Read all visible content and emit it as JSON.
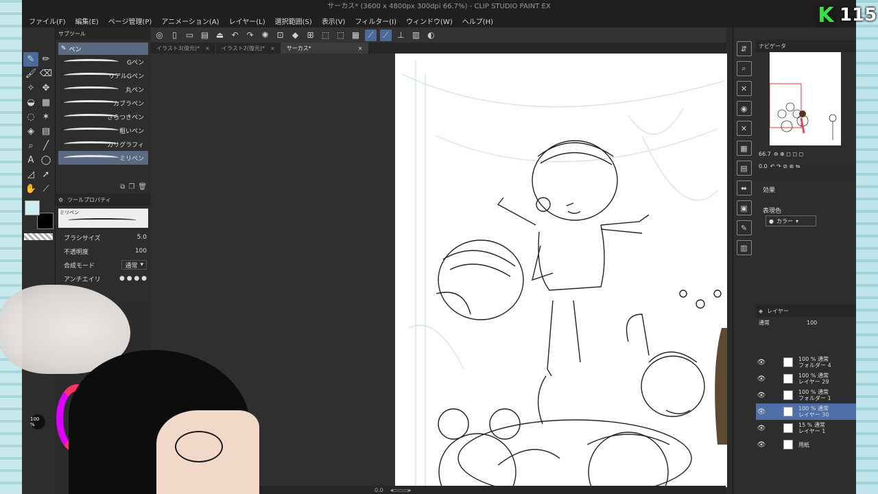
{
  "app": {
    "title": "サーカス* (3600 x 4800px 300dpi 66.7%) - CLIP STUDIO PAINT EX"
  },
  "menu": [
    "ファイル(F)",
    "編集(E)",
    "ページ管理(P)",
    "アニメーション(A)",
    "レイヤー(L)",
    "選択範囲(S)",
    "表示(V)",
    "フィルター(I)",
    "ウィンドウ(W)",
    "ヘルプ(H)"
  ],
  "tabs": [
    {
      "label": "イラスト3(復元)*"
    },
    {
      "label": "イラスト2(復元)*"
    },
    {
      "label": "サーカス*"
    }
  ],
  "subtool": {
    "header": "サブツール",
    "group": "ペン",
    "brushes": [
      "Gペン",
      "リアルGペン",
      "丸ペン",
      "カブラペン",
      "さらつきペン",
      "粗いペン",
      "カリグラフィ",
      "ミリペン"
    ],
    "selected": "ミリペン"
  },
  "toolprop": {
    "header": "ツールプロパティ",
    "preview_name": "ミリペン",
    "brush_size_label": "ブラシサイズ",
    "brush_size": "5.0",
    "opacity_label": "不透明度",
    "opacity": "100",
    "blend_label": "合成モード",
    "blend": "通常",
    "antialias_label": "アンチエイリ"
  },
  "colors": {
    "main": "#cfeef2",
    "sub": "#000000",
    "accent": "#4f6fa8"
  },
  "navigator": {
    "header": "ナビゲータ",
    "zoom": "66.7",
    "rotate": "0.0"
  },
  "effect": {
    "header": "効果",
    "expr_label": "表現色",
    "expr_value": "カラー"
  },
  "layers": {
    "header": "レイヤー",
    "blend": "通常",
    "opacity": "100",
    "items": [
      {
        "line1": "100 % 通常",
        "line2": "フォルダー 4"
      },
      {
        "line1": "100 % 通常",
        "line2": "レイヤー 29"
      },
      {
        "line1": "100 % 通常",
        "line2": "フォルダー 1"
      },
      {
        "line1": "100 % 通常",
        "line2": "レイヤー 30"
      },
      {
        "line1": "15 % 通常",
        "line2": "レイヤー 1"
      },
      {
        "line1": "",
        "line2": "用紙"
      }
    ],
    "selected_index": 3
  },
  "canvas_status": {
    "zoom": "0.0"
  },
  "overlay": {
    "logo_letter": "K",
    "logo_number": "115",
    "percent": "100 %"
  }
}
